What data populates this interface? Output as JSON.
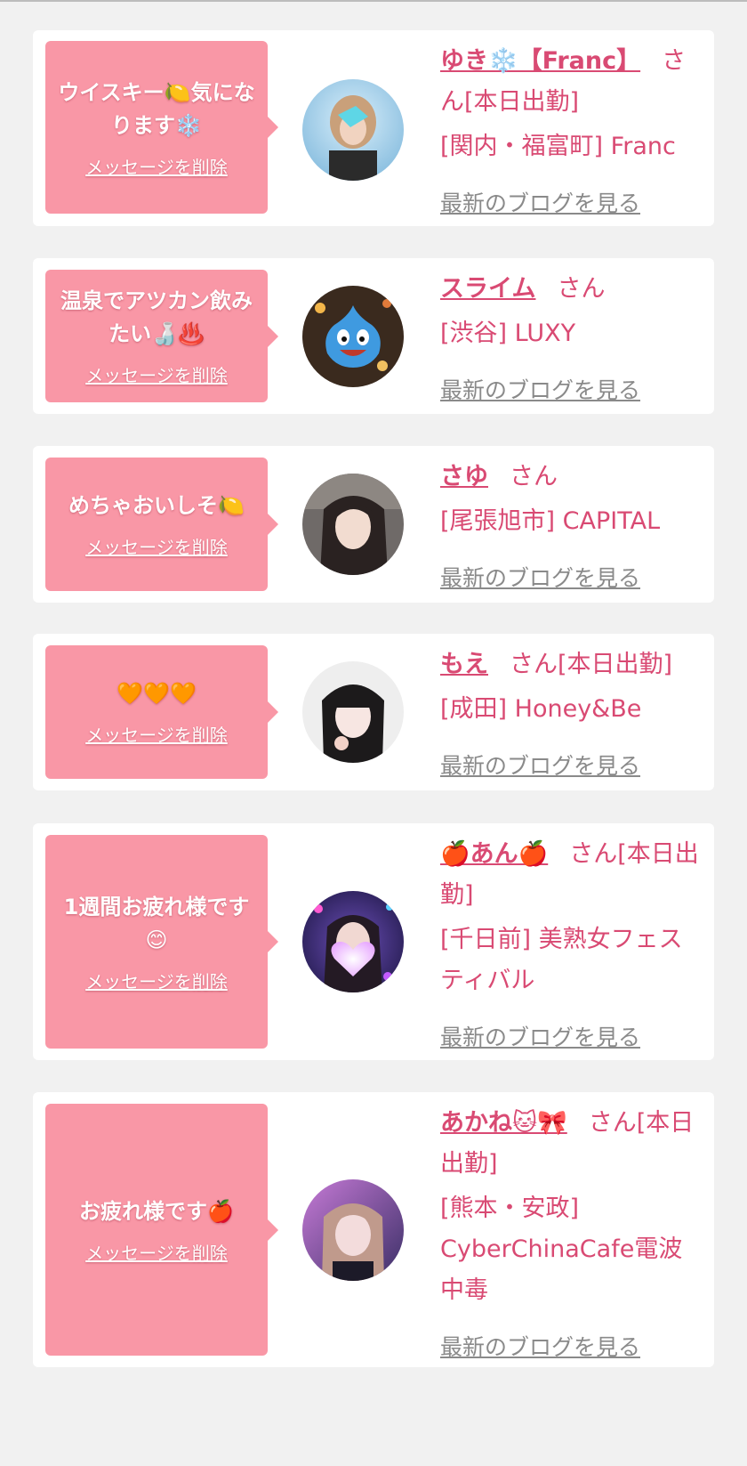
{
  "delete_label": "メッセージを削除",
  "blog_label": "最新のブログを見る",
  "san_suffix": "さん",
  "working_today": "[本日出勤]",
  "colors": {
    "bubble": "#f997a6",
    "name": "#d94a73",
    "blog_link": "#8a8a8a",
    "background": "#f1f1f1"
  },
  "items": [
    {
      "message": "ウイスキー🍋気になります❄️",
      "name": "ゆき❄️【Franc】",
      "working": true,
      "shop": "[関内・福富町] Franc",
      "avatar_icon": "avatar-yuki-icon"
    },
    {
      "message": "温泉でアツカン飲みたい🍶♨️",
      "name": "スライム",
      "working": false,
      "shop": "[渋谷] LUXY",
      "avatar_icon": "avatar-slime-icon"
    },
    {
      "message": "めちゃおいしそ🍋",
      "name": "さゆ",
      "working": false,
      "shop": "[尾張旭市] CAPITAL",
      "avatar_icon": "avatar-sayu-icon"
    },
    {
      "message": "🧡🧡🧡",
      "name": "もえ",
      "working": true,
      "shop": "[成田] Honey&Be",
      "avatar_icon": "avatar-moe-icon"
    },
    {
      "message": "1週間お疲れ様です😊",
      "name": "🍎あん🍎",
      "working": true,
      "shop": "[千日前] 美熟女フェスティバル",
      "avatar_icon": "avatar-an-icon"
    },
    {
      "message": "お疲れ様です🍎",
      "name": "あかね🐱🎀",
      "working": true,
      "shop": "[熊本・安政] CyberChinaCafe電波中毒",
      "avatar_icon": "avatar-akane-icon"
    }
  ]
}
